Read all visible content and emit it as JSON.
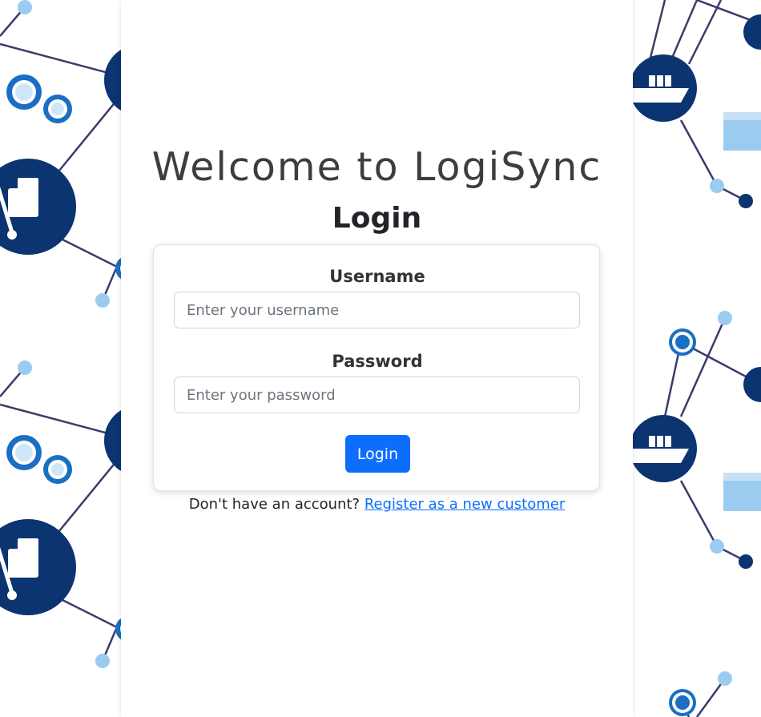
{
  "header": {
    "welcome": "Welcome to LogiSync",
    "login_title": "Login"
  },
  "form": {
    "username_label": "Username",
    "username_placeholder": "Enter your username",
    "password_label": "Password",
    "password_placeholder": "Enter your password",
    "submit_label": "Login"
  },
  "footer": {
    "prompt": "Don't have an account?",
    "register_link": "Register as a new customer"
  },
  "colors": {
    "primary": "#0d6efd",
    "network_dark": "#0b3470",
    "network_light": "#9ccbf0"
  }
}
